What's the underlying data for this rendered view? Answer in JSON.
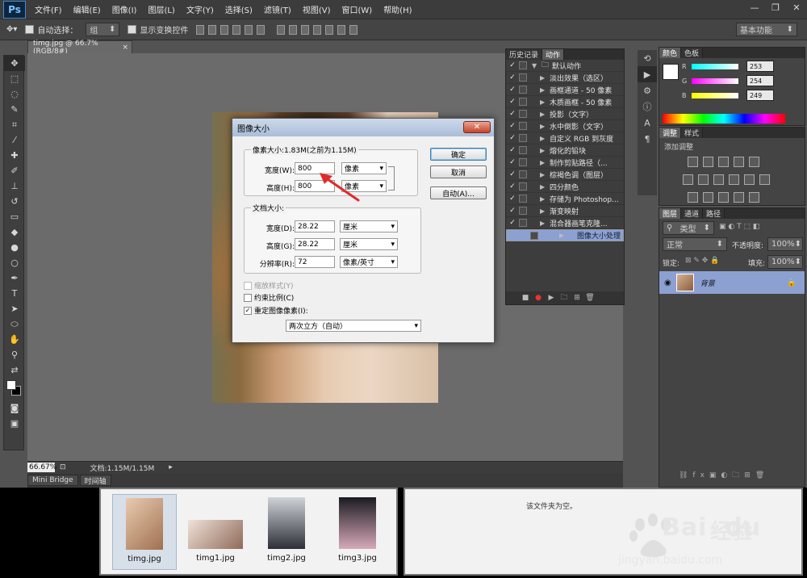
{
  "app": {
    "logo": "Ps"
  },
  "menu": [
    "文件(F)",
    "编辑(E)",
    "图像(I)",
    "图层(L)",
    "文字(Y)",
    "选择(S)",
    "滤镜(T)",
    "视图(V)",
    "窗口(W)",
    "帮助(H)"
  ],
  "window_controls": {
    "minimize": "—",
    "restore": "❐",
    "close": "✕"
  },
  "options": {
    "auto_select_label": "自动选择：",
    "auto_select_value": "组",
    "show_transform_label": "显示变换控件",
    "workspace": "基本功能"
  },
  "document": {
    "tab_title": "timg.jpg @ 66.7%(RGB/8#)",
    "zoom": "66.67%",
    "doc_info": "文档:1.15M/1.15M"
  },
  "bottom_tabs": [
    "Mini Bridge",
    "时间轴"
  ],
  "actions_panel": {
    "tabs": [
      "历史记录",
      "动作"
    ],
    "set_name": "默认动作",
    "items": [
      "淡出效果（选区）",
      "画框通道 - 50 像素",
      "木质画框 - 50 像素",
      "投影（文字）",
      "水中倒影（文字）",
      "自定义 RGB 到灰度",
      "熔化的铅块",
      "制作剪贴路径（...",
      "棕褐色调（图层）",
      "四分颜色",
      "存储为 Photoshop...",
      "渐变映射",
      "混合器画笔克隆...",
      "图像大小处理"
    ]
  },
  "color_panel": {
    "tabs": [
      "颜色",
      "色板"
    ],
    "r_label": "R",
    "g_label": "G",
    "b_label": "B",
    "r": "253",
    "g": "254",
    "b": "249"
  },
  "adjust_panel": {
    "tabs": [
      "调整",
      "样式"
    ],
    "title": "添加调整"
  },
  "layers_panel": {
    "tabs": [
      "图层",
      "通道",
      "路径"
    ],
    "kind": "类型",
    "blend": "正常",
    "opacity_label": "不透明度:",
    "opacity": "100%",
    "lock_label": "锁定:",
    "fill_label": "填充:",
    "fill": "100%",
    "layer_name": "背景"
  },
  "dialog": {
    "title": "图像大小",
    "pixel_dims": "像素大小:1.83M(之前为1.15M)",
    "width_label": "宽度(W):",
    "width_value": "800",
    "width_unit": "像素",
    "height_label": "高度(H):",
    "height_value": "800",
    "height_unit": "像素",
    "doc_size_title": "文档大小:",
    "doc_width_label": "宽度(D):",
    "doc_width_value": "28.22",
    "doc_width_unit": "厘米",
    "doc_height_label": "高度(G):",
    "doc_height_value": "28.22",
    "doc_height_unit": "厘米",
    "resolution_label": "分辨率(R):",
    "resolution_value": "72",
    "resolution_unit": "像素/英寸",
    "scale_styles": "缩放样式(Y)",
    "constrain": "约束比例(C)",
    "resample": "重定图像像素(I):",
    "resample_method": "两次立方（自动）",
    "ok": "确定",
    "cancel": "取消",
    "auto": "自动(A)..."
  },
  "bridge": {
    "thumbs": [
      "timg.jpg",
      "timg1.jpg",
      "timg2.jpg",
      "timg3.jpg"
    ],
    "empty_message": "该文件夹为空。"
  },
  "watermark": {
    "brand": "Bai",
    "brand2": "du",
    "cn": "经验",
    "url": "jingyan.baidu.com"
  },
  "colors": {
    "accent_select": "#8ca0d2",
    "panel_bg": "#444444"
  }
}
